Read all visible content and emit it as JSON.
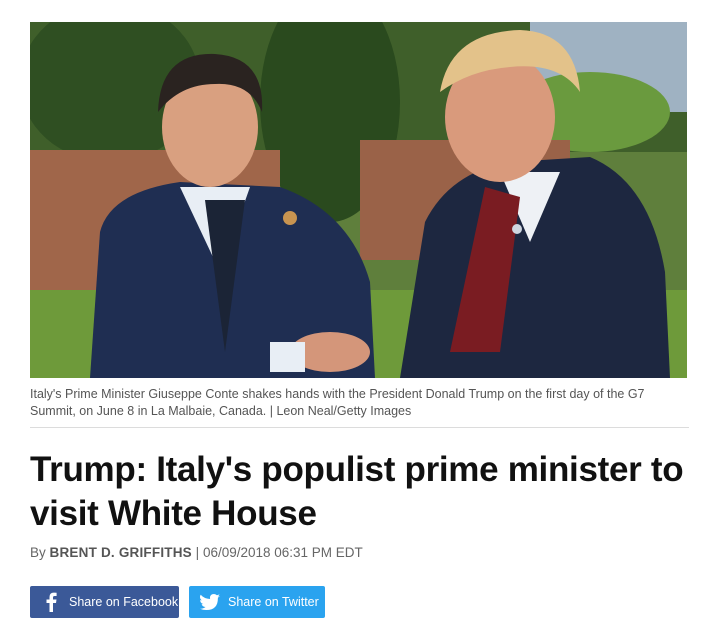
{
  "photo": {
    "alt_subject": "handshake-photo"
  },
  "caption": "Italy's Prime Minister Giuseppe Conte shakes hands with the President Donald Trump on the first day of the G7 Summit, on June 8 in La Malbaie, Canada. | Leon Neal/Getty Images",
  "headline": "Trump: Italy's populist prime minister to visit White House",
  "byline": {
    "prefix": "By",
    "author": "BRENT D. GRIFFITHS",
    "separator": "|",
    "datetime": "06/09/2018 06:31 PM EDT"
  },
  "share": {
    "facebook_label": "Share on Facebook",
    "twitter_label": "Share on Twitter"
  },
  "colors": {
    "facebook": "#3b5998",
    "twitter": "#2aa3ef"
  }
}
